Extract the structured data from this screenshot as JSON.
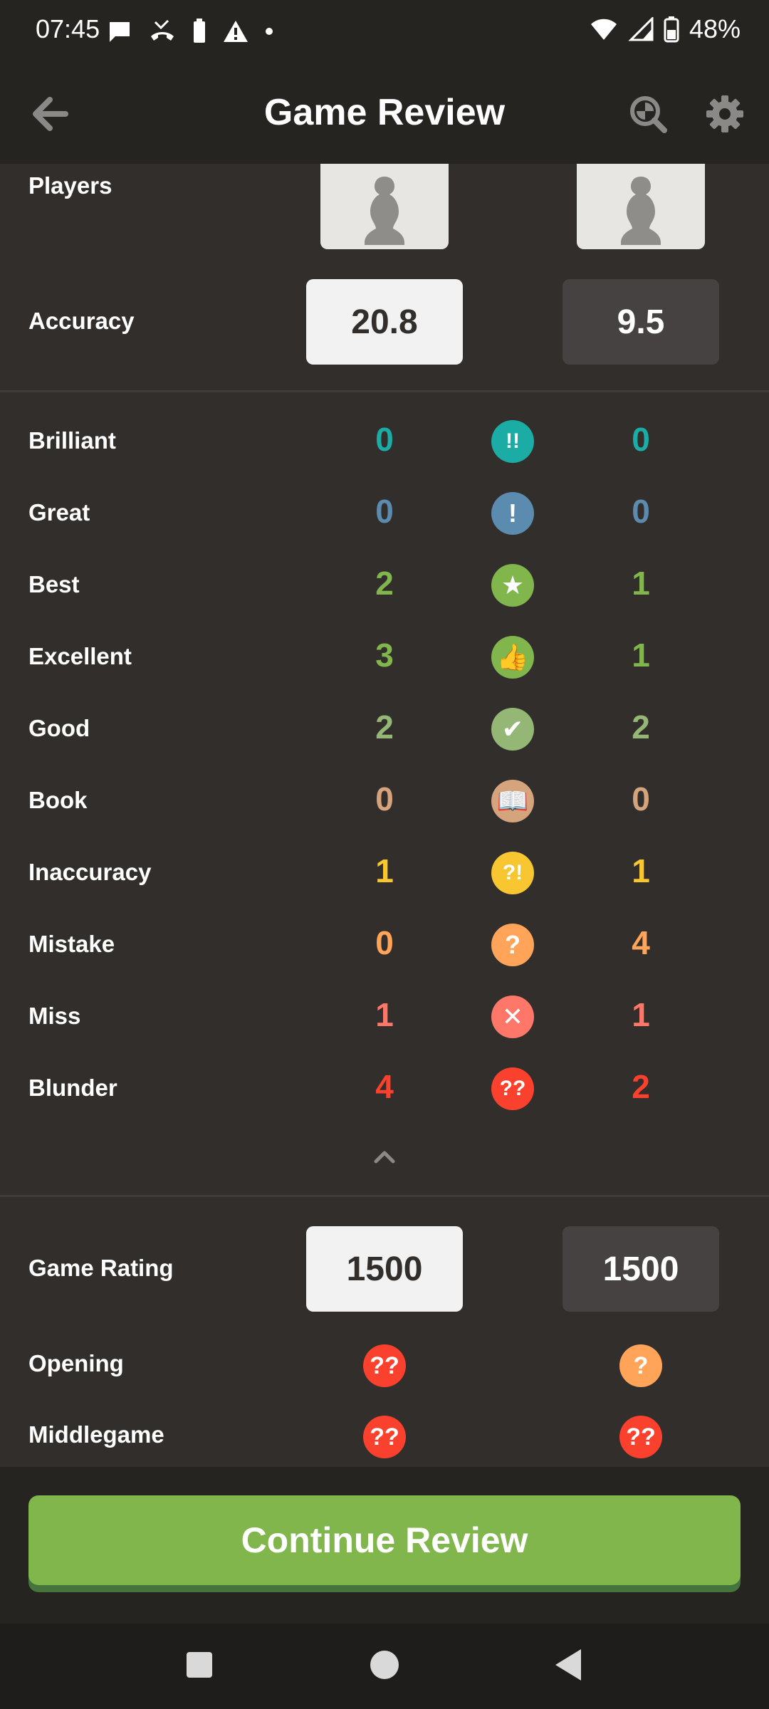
{
  "status_bar": {
    "time": "07:45",
    "battery_percent": "48%",
    "icons_left": [
      "chat-bubble-icon",
      "missed-call-icon",
      "battery-icon",
      "warning-icon",
      "dot-icon"
    ],
    "icons_right": [
      "wifi-icon",
      "signal-icon",
      "battery-icon"
    ]
  },
  "header": {
    "title": "Game Review",
    "back_icon": "arrow-left-icon",
    "analysis_icon": "magnifier-analysis-icon",
    "settings_icon": "gear-icon"
  },
  "players": {
    "label": "Players",
    "avatars": [
      "pawn-avatar",
      "pawn-avatar"
    ]
  },
  "accuracy": {
    "label": "Accuracy",
    "white": "20.8",
    "black": "9.5"
  },
  "move_stats": [
    {
      "label": "Brilliant",
      "white": "0",
      "black": "0",
      "icon": "brilliant-icon",
      "symbol": "!!",
      "color": "#1baca6"
    },
    {
      "label": "Great",
      "white": "0",
      "black": "0",
      "icon": "great-icon",
      "symbol": "!",
      "color": "#5c8bb0"
    },
    {
      "label": "Best",
      "white": "2",
      "black": "1",
      "icon": "star-icon",
      "symbol": "★",
      "color": "#81b64c"
    },
    {
      "label": "Excellent",
      "white": "3",
      "black": "1",
      "icon": "thumbs-up-icon",
      "symbol": "👍",
      "color": "#81b64c"
    },
    {
      "label": "Good",
      "white": "2",
      "black": "2",
      "icon": "checkmark-icon",
      "symbol": "✔",
      "color": "#95b776"
    },
    {
      "label": "Book",
      "white": "0",
      "black": "0",
      "icon": "book-icon",
      "symbol": "📖",
      "color": "#d5a47d"
    },
    {
      "label": "Inaccuracy",
      "white": "1",
      "black": "1",
      "icon": "inaccuracy-icon",
      "symbol": "?!",
      "color": "#f7c631"
    },
    {
      "label": "Mistake",
      "white": "0",
      "black": "4",
      "icon": "mistake-icon",
      "symbol": "?",
      "color": "#ffa459"
    },
    {
      "label": "Miss",
      "white": "1",
      "black": "1",
      "icon": "miss-icon",
      "symbol": "✕",
      "color": "#ff7769"
    },
    {
      "label": "Blunder",
      "white": "4",
      "black": "2",
      "icon": "blunder-icon",
      "symbol": "??",
      "color": "#fa412d"
    }
  ],
  "game_rating": {
    "label": "Game Rating",
    "white": "1500",
    "black": "1500"
  },
  "phases": [
    {
      "label": "Opening",
      "white": {
        "icon": "blunder-icon",
        "symbol": "??",
        "color": "#fa412d"
      },
      "black": {
        "icon": "mistake-icon",
        "symbol": "?",
        "color": "#ffa459"
      }
    },
    {
      "label": "Middlegame",
      "white": {
        "icon": "blunder-icon",
        "symbol": "??",
        "color": "#fa412d"
      },
      "black": {
        "icon": "blunder-icon",
        "symbol": "??",
        "color": "#fa412d"
      }
    }
  ],
  "continue_button": "Continue Review",
  "nav_bar": [
    "recent-apps-icon",
    "home-icon",
    "back-icon"
  ]
}
